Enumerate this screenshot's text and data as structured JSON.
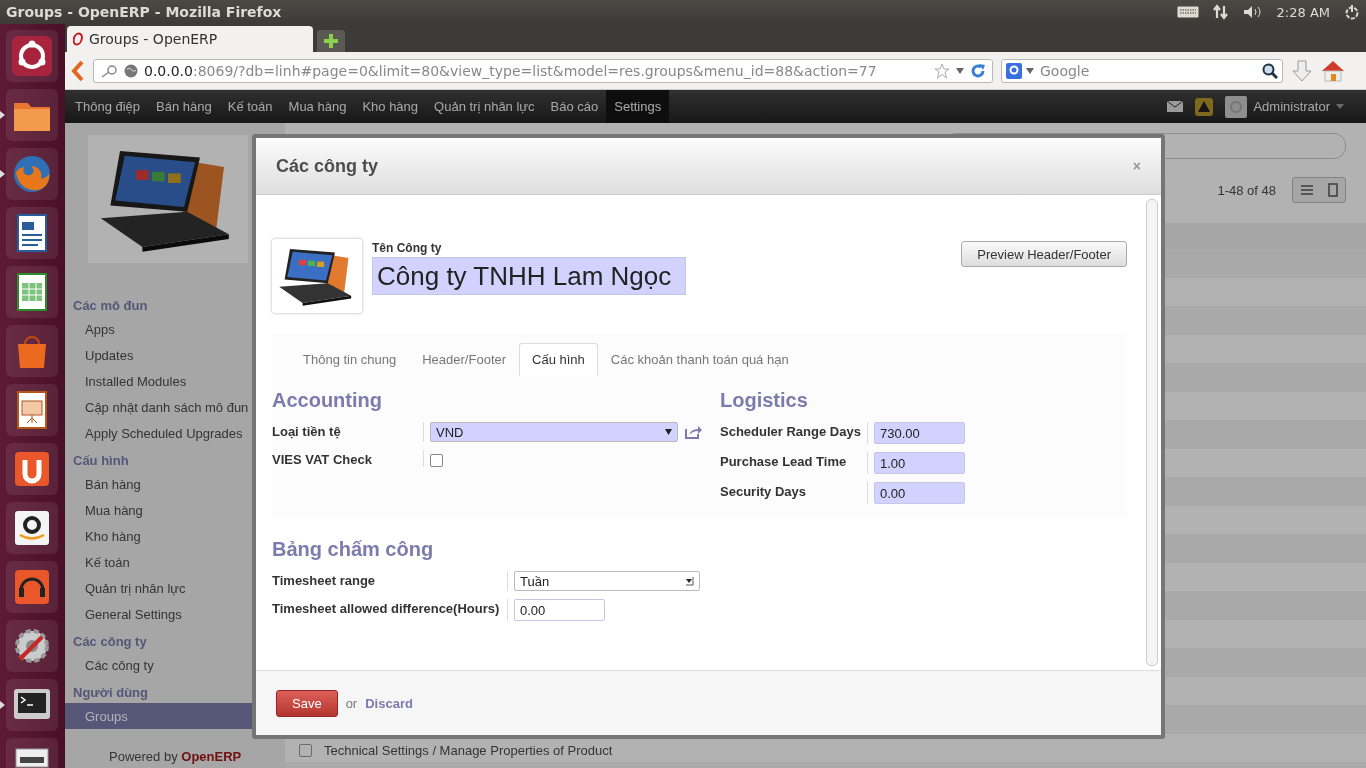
{
  "system_bar": {
    "title": "Groups - OpenERP - Mozilla Firefox",
    "clock": "2:28 AM"
  },
  "launcher": [
    {
      "kind": "ubuntu",
      "running": false
    },
    {
      "kind": "files",
      "running": true
    },
    {
      "kind": "firefox",
      "running": true
    },
    {
      "kind": "writer",
      "running": false
    },
    {
      "kind": "calc",
      "running": false
    },
    {
      "kind": "store",
      "running": false
    },
    {
      "kind": "impress",
      "running": false
    },
    {
      "kind": "ubuntuone",
      "running": false
    },
    {
      "kind": "amazon",
      "running": false
    },
    {
      "kind": "music",
      "running": false
    },
    {
      "kind": "settings",
      "running": false
    },
    {
      "kind": "terminal",
      "running": true
    },
    {
      "kind": "drive",
      "running": false
    }
  ],
  "browser": {
    "tab_title": "Groups - OpenERP",
    "url_host": "0.0.0.0",
    "url_rest": ":8069/?db=linh#page=0&limit=80&view_type=list&model=res.groups&menu_id=88&action=77",
    "search_placeholder": "Google"
  },
  "menu": [
    {
      "label": "Thông điệp",
      "selected": false
    },
    {
      "label": "Bán hàng",
      "selected": false
    },
    {
      "label": "Kế toán",
      "selected": false
    },
    {
      "label": "Mua hàng",
      "selected": false
    },
    {
      "label": "Kho hàng",
      "selected": false
    },
    {
      "label": "Quản trị nhân lực",
      "selected": false
    },
    {
      "label": "Báo cáo",
      "selected": false
    },
    {
      "label": "Settings",
      "selected": true
    }
  ],
  "user": "Administrator",
  "sidebar": {
    "sections": [
      {
        "title": "Các mô đun",
        "items": [
          {
            "label": "Apps",
            "selected": false
          },
          {
            "label": "Updates",
            "selected": false
          },
          {
            "label": "Installed Modules",
            "selected": false
          },
          {
            "label": "Cập nhật danh sách mô đun",
            "selected": false
          },
          {
            "label": "Apply Scheduled Upgrades",
            "selected": false
          }
        ]
      },
      {
        "title": "Cấu hình",
        "items": [
          {
            "label": "Bán hàng",
            "selected": false
          },
          {
            "label": "Mua hàng",
            "selected": false
          },
          {
            "label": "Kho hàng",
            "selected": false
          },
          {
            "label": "Kế toán",
            "selected": false
          },
          {
            "label": "Quản trị nhân lực",
            "selected": false
          },
          {
            "label": "General Settings",
            "selected": false
          }
        ]
      },
      {
        "title": "Các công ty",
        "items": [
          {
            "label": "Các công ty",
            "selected": false
          }
        ]
      },
      {
        "title": "Người dùng",
        "items": [
          {
            "label": "Groups",
            "selected": true
          }
        ]
      }
    ],
    "powered_by": "Powered by",
    "brand": "OpenERP"
  },
  "list": {
    "pager": "1-48 of 48",
    "rows": [
      {
        "label": "Technical Settings / Manage Properties of Product",
        "checked": false
      }
    ]
  },
  "dialog": {
    "title": "Các công ty",
    "close": "×",
    "name_label": "Tên Công ty",
    "name_value": "Công ty TNHH Lam Ngọc",
    "preview_button": "Preview Header/Footer",
    "tabs": [
      {
        "label": "Thông tin chung",
        "selected": false
      },
      {
        "label": "Header/Footer",
        "selected": false
      },
      {
        "label": "Cấu hình",
        "selected": true
      },
      {
        "label": "Các khoản thanh toán quá hạn",
        "selected": false
      }
    ],
    "accounting": {
      "title": "Accounting",
      "currency_label": "Loại tiền tệ",
      "currency": "VND",
      "vat_label": "VIES VAT Check",
      "vat_checked": false
    },
    "logistics": {
      "title": "Logistics",
      "fields": [
        {
          "label": "Scheduler Range Days",
          "value": "730.00",
          "required": true
        },
        {
          "label": "Purchase Lead Time",
          "value": "1.00",
          "required": true
        },
        {
          "label": "Security Days",
          "value": "0.00",
          "required": true
        }
      ]
    },
    "timesheet": {
      "title": "Bảng chấm công",
      "range_label": "Timesheet range",
      "range": "Tuần",
      "diff_label": "Timesheet allowed difference(Hours)",
      "diff": "0.00",
      "diff_required": false
    },
    "save": "Save",
    "or": "or",
    "discard": "Discard"
  }
}
